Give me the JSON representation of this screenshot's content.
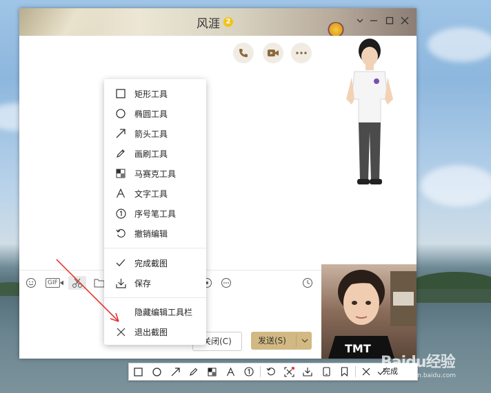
{
  "chat": {
    "title": "风涯",
    "vip_level": "2",
    "window_controls": [
      "minimize-icon",
      "maximize-icon",
      "close-icon"
    ],
    "call_buttons": [
      "phone-icon",
      "video-icon",
      "more-icon"
    ],
    "toolbar_icons": [
      "emoji-icon",
      "gif-icon",
      "scissors-icon",
      "folder-icon",
      "image-icon",
      "file-icon",
      "camera-icon",
      "more-icon",
      "history-icon"
    ],
    "gif_label": "GIF",
    "close_label": "关闭(C)",
    "send_label": "发送(S)"
  },
  "context_menu": {
    "items": [
      {
        "label": "矩形工具",
        "icon": "rectangle-icon"
      },
      {
        "label": "椭圆工具",
        "icon": "ellipse-icon"
      },
      {
        "label": "箭头工具",
        "icon": "arrow-icon"
      },
      {
        "label": "画刷工具",
        "icon": "pencil-icon"
      },
      {
        "label": "马赛克工具",
        "icon": "mosaic-icon"
      },
      {
        "label": "文字工具",
        "icon": "text-icon"
      },
      {
        "label": "序号笔工具",
        "icon": "number-pen-icon"
      },
      {
        "label": "撤销编辑",
        "icon": "undo-icon"
      },
      {
        "label": "完成截图",
        "icon": "check-icon"
      },
      {
        "label": "保存",
        "icon": "download-icon"
      },
      {
        "label": "隐藏编辑工具栏",
        "icon": ""
      },
      {
        "label": "退出截图",
        "icon": "close-icon"
      }
    ]
  },
  "snip_toolbar": {
    "icons": [
      "rectangle-icon",
      "ellipse-icon",
      "arrow-icon",
      "pencil-icon",
      "mosaic-icon",
      "text-icon",
      "number-pen-icon",
      "undo-icon",
      "ocr-icon",
      "download-icon",
      "phone-send-icon",
      "bookmark-icon",
      "close-icon",
      "check-icon"
    ],
    "done_label": "完成"
  },
  "watermark": {
    "brand": "Baidu经验",
    "url": "jingyan.baidu.com"
  },
  "colors": {
    "send_button": "#d2b883",
    "annotation_arrow": "#e8322f",
    "vip_badge": "#f2c21a"
  }
}
